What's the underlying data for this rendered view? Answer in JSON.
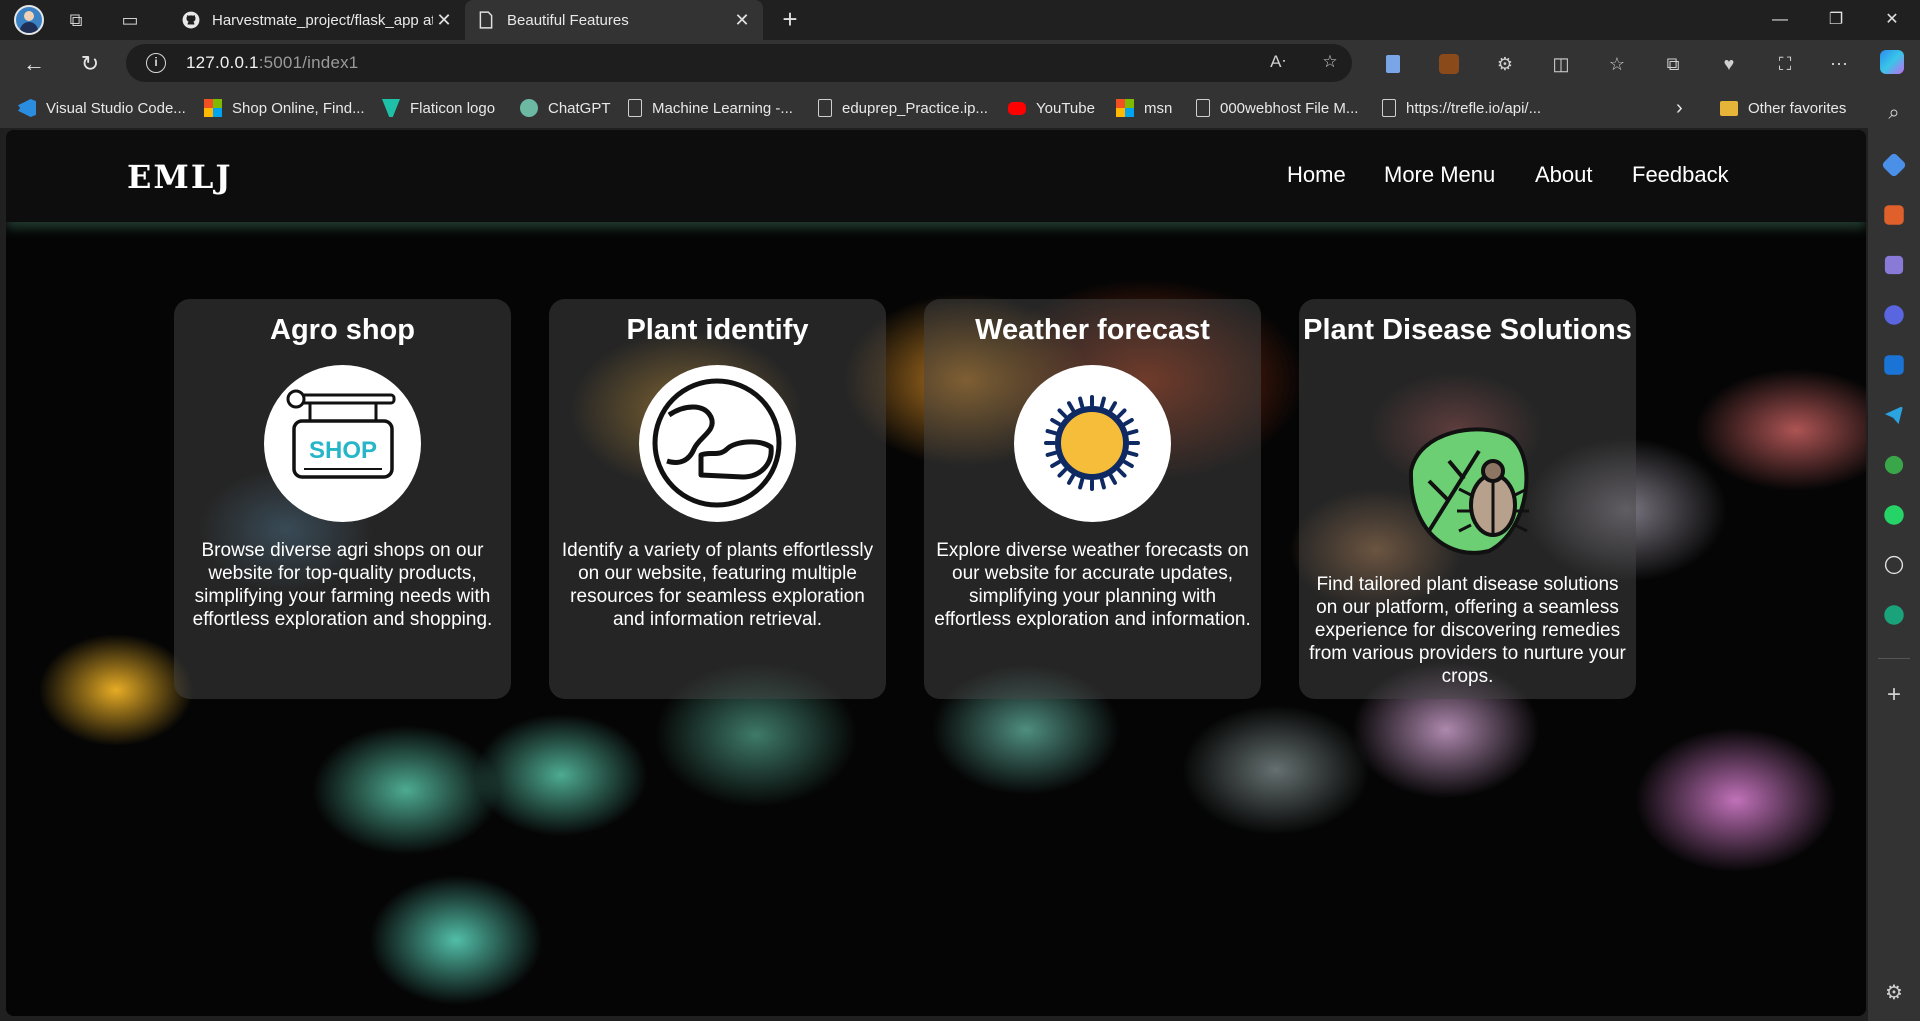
{
  "browser": {
    "tabs": [
      {
        "title": "Harvestmate_project/flask_app at",
        "active": false
      },
      {
        "title": "Beautiful Features",
        "active": true
      }
    ],
    "address": {
      "host": "127.0.0.1",
      "rest": ":5001/index1"
    },
    "favorites": [
      {
        "label": "Visual Studio Code...",
        "icon": "vscode-icon"
      },
      {
        "label": "Shop Online, Find...",
        "icon": "microsoft-icon"
      },
      {
        "label": "Flaticon logo",
        "icon": "flaticon-icon"
      },
      {
        "label": "ChatGPT",
        "icon": "chatgpt-icon"
      },
      {
        "label": "Machine Learning -...",
        "icon": "page-icon"
      },
      {
        "label": "eduprep_Practice.ip...",
        "icon": "page-icon"
      },
      {
        "label": "YouTube",
        "icon": "youtube-icon"
      },
      {
        "label": "msn",
        "icon": "microsoft-icon"
      },
      {
        "label": "000webhost File M...",
        "icon": "page-icon"
      },
      {
        "label": "https://trefle.io/api/...",
        "icon": "page-icon"
      }
    ],
    "other_favorites": "Other favorites"
  },
  "page": {
    "logo": "EMLJ",
    "menu": [
      "Home",
      "More Menu",
      "About",
      "Feedback"
    ],
    "cards": [
      {
        "title": "Agro shop",
        "icon": "shop-sign-icon",
        "text": "Browse diverse agri shops on our website for top-quality products, simplifying your farming needs with effortless exploration and shopping."
      },
      {
        "title": "Plant identify",
        "icon": "globe-map-icon",
        "text": "Identify a variety of plants effortlessly on our website, featuring multiple resources for seamless exploration and information retrieval."
      },
      {
        "title": "Weather forecast",
        "icon": "sun-icon",
        "text": "Explore diverse weather forecasts on our website for accurate updates, simplifying your planning with effortless exploration and information."
      },
      {
        "title": "Plant Disease Solutions",
        "icon": "beetle-on-leaf-icon",
        "text": "Find tailored plant disease solutions on our platform, offering a seamless experience for discovering remedies from various providers to nurture your crops."
      }
    ]
  }
}
